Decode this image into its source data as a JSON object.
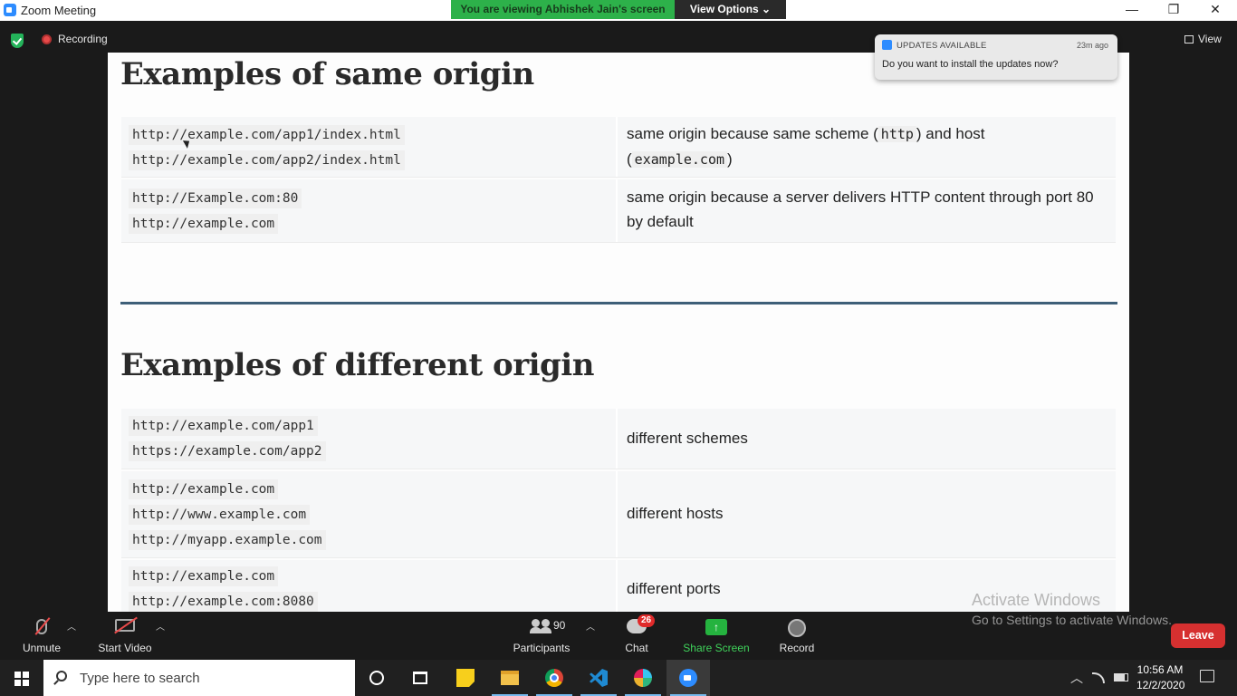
{
  "window": {
    "title": "Zoom Meeting",
    "minimize": "—",
    "restore": "❐",
    "close": "✕"
  },
  "banner": {
    "viewing": "You are viewing Abhishek Jain's screen",
    "view_options": "View Options ⌄"
  },
  "top": {
    "recording": "Recording",
    "view": "View"
  },
  "notification": {
    "title": "UPDATES AVAILABLE",
    "time": "23m ago",
    "message": "Do you want to install the updates now?"
  },
  "slide": {
    "same_heading": "Examples of same origin",
    "same_rows": [
      {
        "urls": [
          "http://example.com/app1/index.html",
          "http://example.com/app2/index.html"
        ],
        "desc_parts": [
          "same origin because same scheme (",
          "http",
          ") and host",
          "(",
          "example.com",
          ")"
        ]
      },
      {
        "urls": [
          "http://Example.com:80",
          "http://example.com"
        ],
        "desc_parts": [
          "same origin because a server delivers HTTP content through port 80",
          "by default"
        ]
      }
    ],
    "diff_heading": "Examples of different origin",
    "diff_rows": [
      {
        "urls": [
          "http://example.com/app1",
          "https://example.com/app2"
        ],
        "desc": "different schemes"
      },
      {
        "urls": [
          "http://example.com",
          "http://www.example.com",
          "http://myapp.example.com"
        ],
        "desc": "different hosts"
      },
      {
        "urls": [
          "http://example.com",
          "http://example.com:8080"
        ],
        "desc": "different ports"
      }
    ]
  },
  "watermark": {
    "line1": "Activate Windows",
    "line2": "Go to Settings to activate Windows."
  },
  "toolbar": {
    "unmute": "Unmute",
    "start_video": "Start Video",
    "participants": "Participants",
    "participants_count": "90",
    "chat": "Chat",
    "chat_badge": "26",
    "share_screen": "Share Screen",
    "record": "Record",
    "leave": "Leave"
  },
  "taskbar": {
    "search_placeholder": "Type here to search",
    "time": "10:56 AM",
    "date": "12/2/2020"
  }
}
